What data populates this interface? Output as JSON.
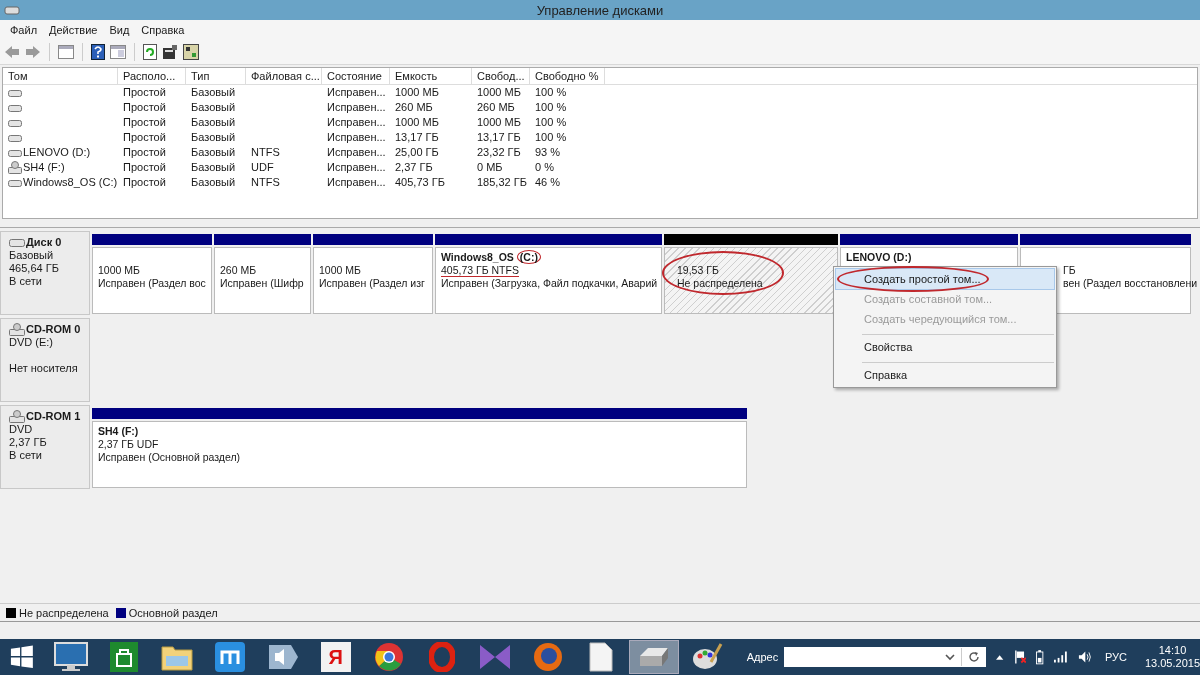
{
  "window": {
    "title": "Управление дисками"
  },
  "menu": [
    "Файл",
    "Действие",
    "Вид",
    "Справка"
  ],
  "volumes": {
    "columns": [
      "Том",
      "Располо...",
      "Тип",
      "Файловая с...",
      "Состояние",
      "Емкость",
      "Свобод...",
      "Свободно %"
    ],
    "rows": [
      {
        "kind": "disk",
        "layout": "Простой",
        "type": "Базовый",
        "status": "Исправен...",
        "capacity": "1000 МБ",
        "free": "1000 МБ",
        "free_pct": "100 %"
      },
      {
        "kind": "disk",
        "layout": "Простой",
        "type": "Базовый",
        "status": "Исправен...",
        "capacity": "260 МБ",
        "free": "260 МБ",
        "free_pct": "100 %"
      },
      {
        "kind": "disk",
        "layout": "Простой",
        "type": "Базовый",
        "status": "Исправен...",
        "capacity": "1000 МБ",
        "free": "1000 МБ",
        "free_pct": "100 %"
      },
      {
        "kind": "disk",
        "layout": "Простой",
        "type": "Базовый",
        "status": "Исправен...",
        "capacity": "13,17 ГБ",
        "free": "13,17 ГБ",
        "free_pct": "100 %"
      },
      {
        "kind": "disk",
        "volume": "LENOVO (D:)",
        "layout": "Простой",
        "type": "Базовый",
        "fs": "NTFS",
        "status": "Исправен...",
        "capacity": "25,00 ГБ",
        "free": "23,32 ГБ",
        "free_pct": "93 %"
      },
      {
        "kind": "cdrom",
        "volume": "SH4 (F:)",
        "layout": "Простой",
        "type": "Базовый",
        "fs": "UDF",
        "status": "Исправен...",
        "capacity": "2,37 ГБ",
        "free": "0 МБ",
        "free_pct": "0 %"
      },
      {
        "kind": "disk",
        "volume": "Windows8_OS (C:)",
        "layout": "Простой",
        "type": "Базовый",
        "fs": "NTFS",
        "status": "Исправен...",
        "capacity": "405,73 ГБ",
        "free": "185,32 ГБ",
        "free_pct": "46 %"
      }
    ]
  },
  "disks": [
    {
      "kind": "disk",
      "name": "Диск 0",
      "type": "Базовый",
      "size": "465,64 ГБ",
      "status": "В сети",
      "partitions": [
        {
          "kind": "primary",
          "size": "1000 МБ",
          "status": "Исправен (Раздел вос"
        },
        {
          "kind": "primary",
          "size": "260 МБ",
          "status": "Исправен (Шифр"
        },
        {
          "kind": "primary",
          "size": "1000 МБ",
          "status": "Исправен (Раздел изг"
        },
        {
          "kind": "primary",
          "name": "Windows8_OS",
          "letter": "(C:)",
          "letter_circled": true,
          "size": "405,73 ГБ NTFS",
          "size_underlined": true,
          "status": "Исправен (Загрузка, Файл подкачки, Аварий"
        },
        {
          "kind": "unallocated",
          "size": "19,53 ГБ",
          "status": "Не распределена",
          "circled": true
        },
        {
          "kind": "primary",
          "name": "LENOVO",
          "letter": "(D:)"
        },
        {
          "kind": "primary",
          "size": "ГБ",
          "status": "вен (Раздел восстановлени"
        }
      ]
    },
    {
      "kind": "cdrom",
      "name": "CD-ROM 0",
      "type": "DVD (E:)",
      "status": "Нет носителя"
    },
    {
      "kind": "cdrom",
      "name": "CD-ROM 1",
      "type": "DVD",
      "size": "2,37 ГБ",
      "status": "В сети",
      "partitions": [
        {
          "kind": "primary",
          "name": "SH4",
          "letter": "(F:)",
          "size": "2,37 ГБ UDF",
          "status": "Исправен (Основной раздел)"
        }
      ]
    }
  ],
  "context_menu": [
    {
      "label": "Создать простой том...",
      "disabled": false,
      "selected": true,
      "circled": true,
      "separator_before": false
    },
    {
      "label": "Создать составной том...",
      "disabled": true,
      "selected": false,
      "circled": false,
      "separator_before": false
    },
    {
      "label": "Создать чередующийся том...",
      "disabled": true,
      "selected": false,
      "circled": false,
      "separator_before": false
    },
    {
      "label": "Свойства",
      "disabled": false,
      "selected": false,
      "circled": false,
      "separator_before": true
    },
    {
      "label": "Справка",
      "disabled": false,
      "selected": false,
      "circled": false,
      "separator_before": true
    }
  ],
  "legend": [
    {
      "label": "Не распределена",
      "color": "#000000"
    },
    {
      "label": "Основной раздел",
      "color": "#000080"
    }
  ],
  "taskbar": {
    "apps": [
      {
        "kind": "monitor",
        "selected": false
      },
      {
        "kind": "store",
        "selected": false
      },
      {
        "kind": "folder",
        "selected": false
      },
      {
        "kind": "maxthon",
        "selected": false
      },
      {
        "kind": "speaker",
        "selected": false
      },
      {
        "kind": "yandex",
        "label": "Я",
        "selected": false
      },
      {
        "kind": "chrome",
        "selected": false
      },
      {
        "kind": "opera",
        "selected": false
      },
      {
        "kind": "vs",
        "selected": false
      },
      {
        "kind": "firefox",
        "selected": false
      },
      {
        "kind": "document",
        "selected": false
      },
      {
        "kind": "disk-manager",
        "selected": true
      },
      {
        "kind": "paint",
        "selected": false
      }
    ],
    "address_label": "Адрес",
    "language": "РУС",
    "time": "14:10",
    "date": "13.05.2015"
  }
}
